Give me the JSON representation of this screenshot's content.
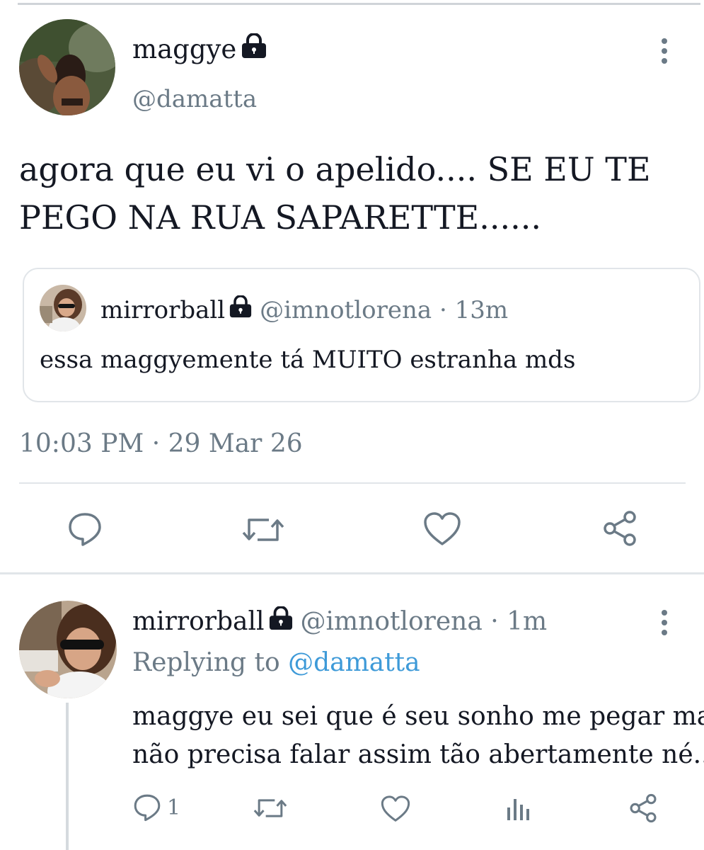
{
  "main_tweet": {
    "display_name": "maggye",
    "handle": "@damatta",
    "text_line1": "agora que eu vi o apelido.... SE EU TE",
    "text_line2": "PEGO NA RUA SAPARETTE......",
    "timestamp": "10:03 PM · 29 Mar 26"
  },
  "quoted_tweet": {
    "display_name": "mirrorball",
    "handle": "@imnotlorena · 13m",
    "text": "essa maggyemente tá MUITO estranha mds"
  },
  "reply": {
    "display_name": "mirrorball",
    "handle": "@imnotlorena · 1m",
    "replying_prefix": "Replying to",
    "replying_handle": "@damatta",
    "text_line1": "maggye eu sei que é seu sonho me pegar mas",
    "text_line2": "não precisa falar assim tão abertamente né....",
    "reply_count": "1"
  },
  "colors": {
    "text": "#141823",
    "muted": "#6b7a86",
    "link": "#3e9ad8",
    "divider": "#e1e5e9"
  },
  "icons": [
    "lock-icon",
    "more-options-icon",
    "reply-icon",
    "retweet-icon",
    "like-icon",
    "share-icon",
    "analytics-icon"
  ]
}
